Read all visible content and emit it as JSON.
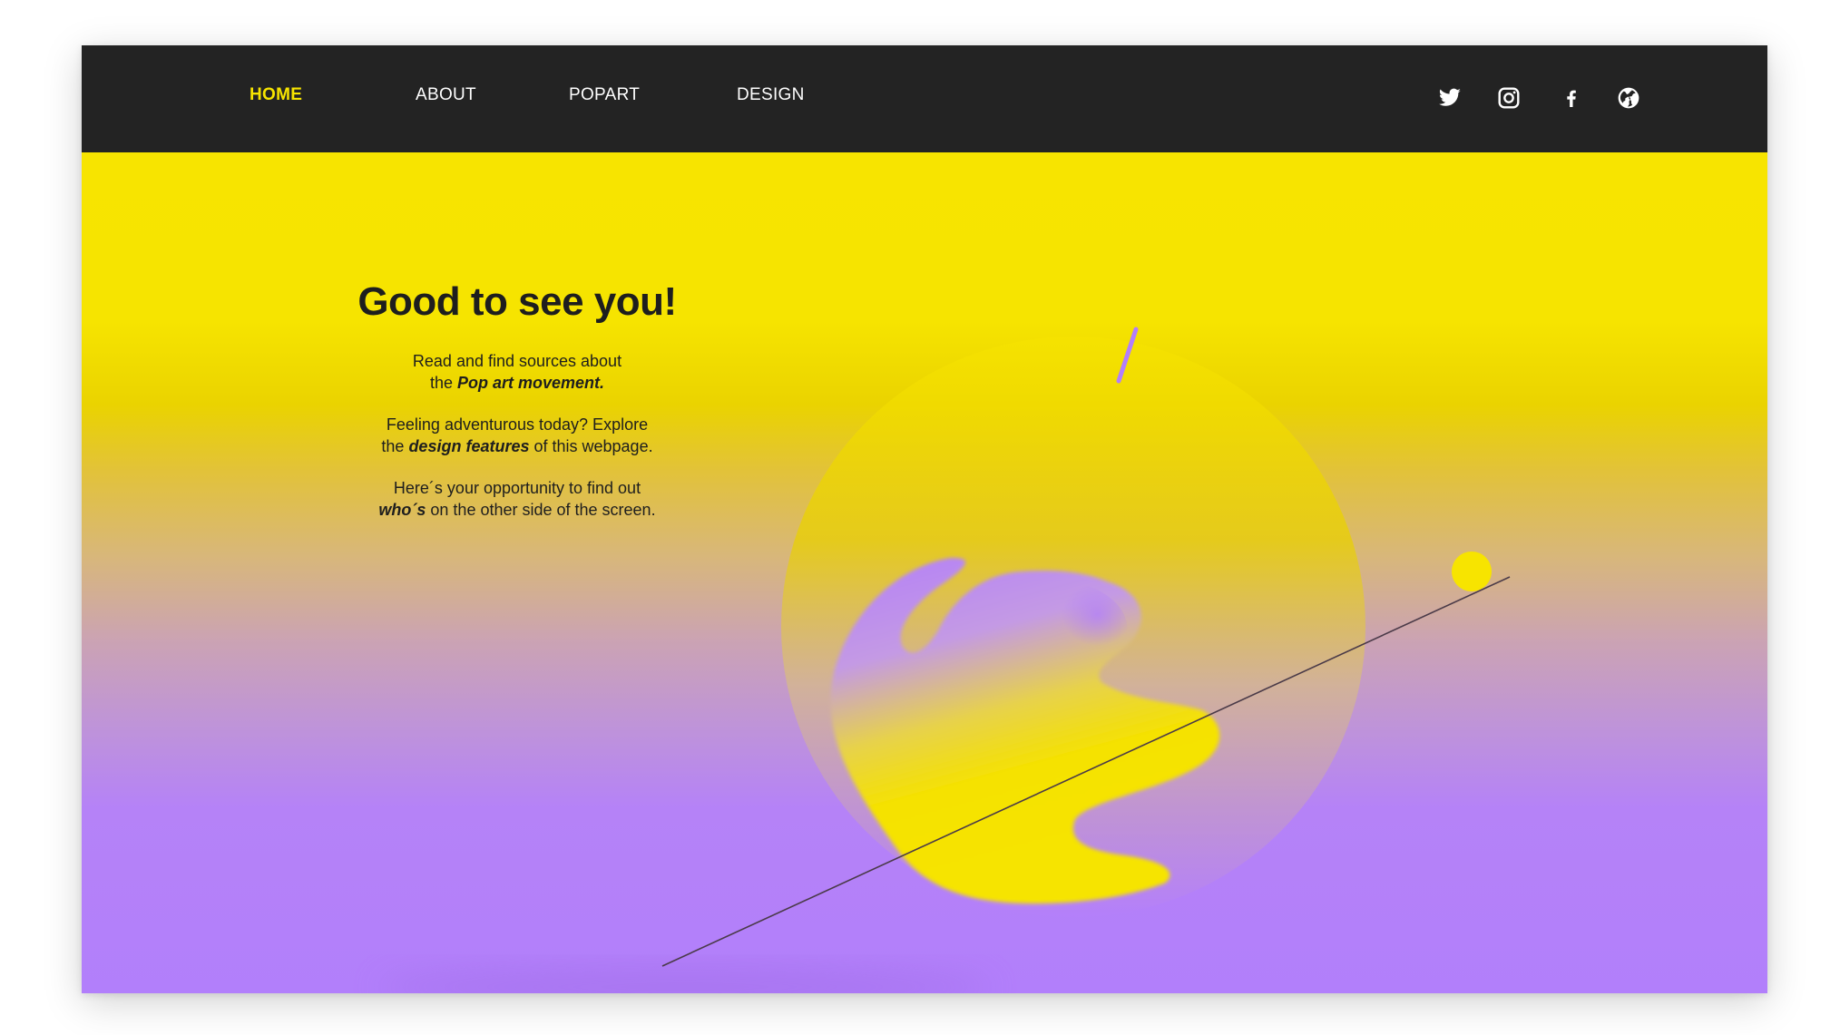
{
  "nav": {
    "items": [
      {
        "label": "HOME",
        "active": true
      },
      {
        "label": "ABOUT",
        "active": false
      },
      {
        "label": "POPART",
        "active": false
      },
      {
        "label": "DESIGN",
        "active": false
      }
    ],
    "social_icons": [
      "twitter-icon",
      "instagram-icon",
      "facebook-icon",
      "globe-icon"
    ]
  },
  "hero": {
    "title": "Good to see you!",
    "p1_line1": "Read and find sources about",
    "p1_line2_pre": "the ",
    "p1_line2_bold": "Pop art movement.",
    "p2_line1": "Feeling adventurous today? Explore",
    "p2_line2_pre": "the ",
    "p2_line2_bold": "design features",
    "p2_line2_post": " of this webpage.",
    "p3_line1": "Here´s your opportunity to find out",
    "p3_line2_bold": "who´s",
    "p3_line2_post": " on the other side of the screen."
  },
  "colors": {
    "accent_yellow": "#f7e400",
    "accent_purple": "#b27ffb",
    "nav_bg": "#232323"
  }
}
